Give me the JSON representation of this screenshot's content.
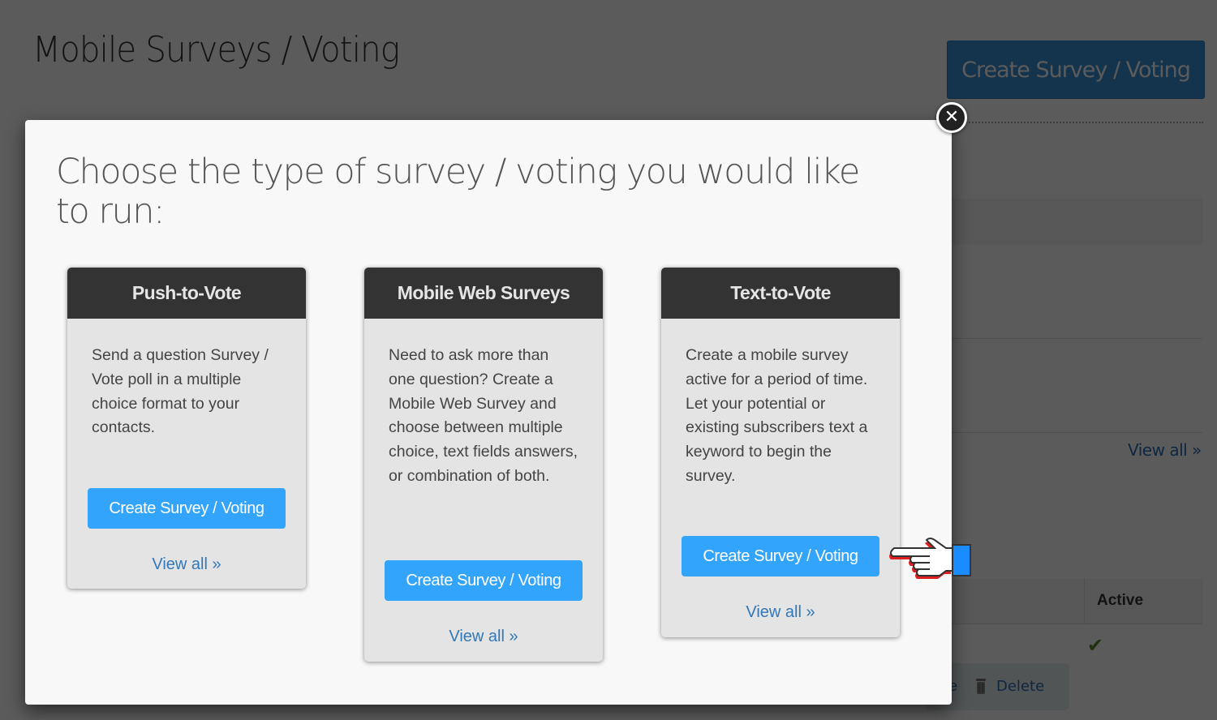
{
  "page": {
    "title": "Mobile Surveys / Voting",
    "create_button_label": "Create Survey / Voting",
    "view_all_label": "View all »",
    "table": {
      "active_header": "Active",
      "active_icon": "check-icon",
      "edit_label_fragment": "e",
      "delete_label": "Delete"
    }
  },
  "modal": {
    "heading": "Choose the type of survey / voting you would like to run:",
    "close_icon": "close-icon",
    "cards": [
      {
        "title": "Push-to-Vote",
        "description": "Send a question Survey / Vote poll in a multiple choice format to your contacts.",
        "button_label": "Create Survey / Voting",
        "link_label": "View all »"
      },
      {
        "title": "Mobile Web Surveys",
        "description": "Need to ask more than one question? Create a Mobile Web Survey and choose between multiple choice, text fields answers, or combination of both.",
        "button_label": "Create Survey / Voting",
        "link_label": "View all »"
      },
      {
        "title": "Text-to-Vote",
        "description": "Create a mobile survey active for a period of time. Let your potential or existing subscribers text a keyword to begin the survey.",
        "button_label": "Create Survey / Voting",
        "link_label": "View all »"
      }
    ]
  },
  "pointer": {
    "icon": "pointing-hand-icon"
  },
  "colors": {
    "primary_button": "#33a4fc",
    "card_header": "#333333",
    "link": "#3278b8",
    "overlay": "#5a5958"
  }
}
